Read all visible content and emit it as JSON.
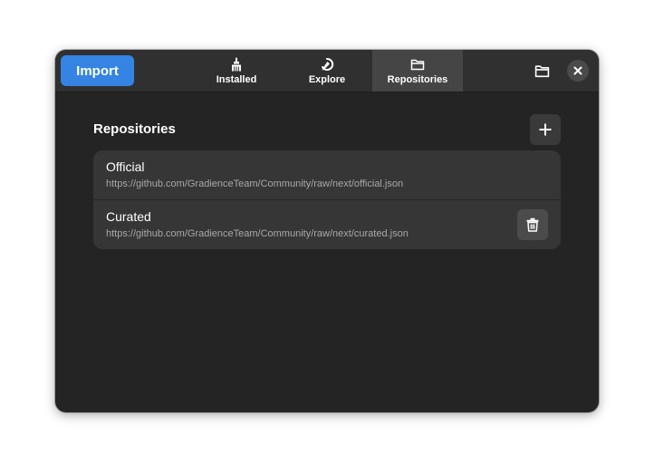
{
  "header": {
    "import_label": "Import",
    "tabs": [
      {
        "label": "Installed",
        "icon": "brush-icon",
        "active": false
      },
      {
        "label": "Explore",
        "icon": "explore-icon",
        "active": false
      },
      {
        "label": "Repositories",
        "icon": "folder-icon",
        "active": true
      }
    ],
    "open_folder_icon": "folder-icon",
    "close_icon": "close-icon"
  },
  "main": {
    "section_title": "Repositories",
    "add_icon": "plus-icon",
    "repositories": [
      {
        "name": "Official",
        "url": "https://github.com/GradienceTeam/Community/raw/next/official.json",
        "deletable": false
      },
      {
        "name": "Curated",
        "url": "https://github.com/GradienceTeam/Community/raw/next/curated.json",
        "deletable": true
      }
    ],
    "delete_icon": "trash-icon"
  },
  "colors": {
    "accent": "#3584e4",
    "window_bg": "#242424",
    "headerbar_bg": "#303030",
    "list_bg": "#363636"
  }
}
